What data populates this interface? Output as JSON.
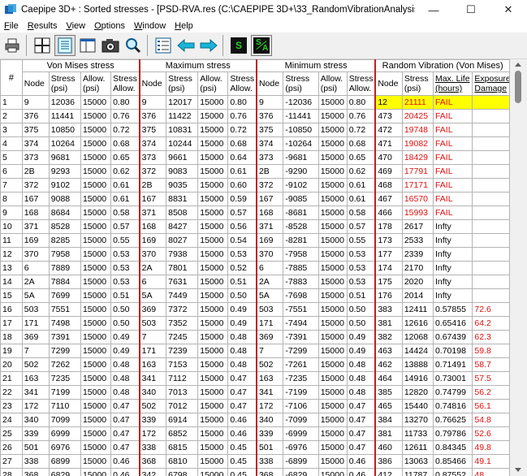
{
  "window": {
    "title": "Caepipe 3D+ : Sorted stresses -  [PSD-RVA.res (C:\\CAEPIPE 3D+\\33_RandomVibrationAnalysis)]",
    "minimize_glyph": "—",
    "maximize_glyph": "☐",
    "close_glyph": "✕"
  },
  "menu": [
    {
      "key": "F",
      "rest": "ile"
    },
    {
      "key": "R",
      "rest": "esults"
    },
    {
      "key": "V",
      "rest": "iew"
    },
    {
      "key": "O",
      "rest": "ptions"
    },
    {
      "key": "W",
      "rest": "indow"
    },
    {
      "key": "H",
      "rest": "elp"
    }
  ],
  "toolbar": {
    "icons": [
      "print-icon",
      "grid-icon",
      "sorted-stresses-icon",
      "window-icon",
      "camera-icon",
      "zoom-icon",
      "list-icon",
      "arrow-left-icon",
      "arrow-right-icon",
      "s-icon",
      "sa-icon"
    ],
    "s_label": "S",
    "sa_label_s": "S",
    "sa_label_a": "A"
  },
  "colors": {
    "accent_red": "#e01010",
    "highlight": "#ffff00",
    "separator": "#c02020",
    "toolbar_green": "#0a8a0a",
    "arrow_cyan": "#19b5d8"
  },
  "grid": {
    "hash_label": "#",
    "groups": {
      "von_mises": "Von Mises stress",
      "maximum": "Maximum stress",
      "minimum": "Minimum stress",
      "random": "Random Vibration (Von Mises)"
    },
    "col_headers": {
      "node": "Node",
      "stress_1": "Stress",
      "stress_2": "(psi)",
      "allow_1": "Allow.",
      "allow_2": "(psi)",
      "sallow_1": "Stress",
      "sallow_2": "Allow.",
      "life_1": "Max. Life",
      "life_2": "(hours)",
      "exposure_1": "Exposure",
      "exposure_2": "Damage"
    },
    "rows": [
      {
        "n": "1",
        "vn": "9",
        "vs": "12036",
        "va": "15000",
        "vr": "0.80",
        "xn": "9",
        "xs": "12017",
        "xa": "15000",
        "xr": "0.80",
        "mn": "9",
        "ms": "-12036",
        "ma": "15000",
        "mr": "0.80",
        "rn": "12",
        "rs": "21111",
        "rl": "FAIL",
        "rd": ""
      },
      {
        "n": "2",
        "vn": "376",
        "vs": "11441",
        "va": "15000",
        "vr": "0.76",
        "xn": "376",
        "xs": "11422",
        "xa": "15000",
        "xr": "0.76",
        "mn": "376",
        "ms": "-11441",
        "ma": "15000",
        "mr": "0.76",
        "rn": "473",
        "rs": "20425",
        "rl": "FAIL",
        "rd": ""
      },
      {
        "n": "3",
        "vn": "375",
        "vs": "10850",
        "va": "15000",
        "vr": "0.72",
        "xn": "375",
        "xs": "10831",
        "xa": "15000",
        "xr": "0.72",
        "mn": "375",
        "ms": "-10850",
        "ma": "15000",
        "mr": "0.72",
        "rn": "472",
        "rs": "19748",
        "rl": "FAIL",
        "rd": ""
      },
      {
        "n": "4",
        "vn": "374",
        "vs": "10264",
        "va": "15000",
        "vr": "0.68",
        "xn": "374",
        "xs": "10244",
        "xa": "15000",
        "xr": "0.68",
        "mn": "374",
        "ms": "-10264",
        "ma": "15000",
        "mr": "0.68",
        "rn": "471",
        "rs": "19082",
        "rl": "FAIL",
        "rd": ""
      },
      {
        "n": "5",
        "vn": "373",
        "vs": "9681",
        "va": "15000",
        "vr": "0.65",
        "xn": "373",
        "xs": "9661",
        "xa": "15000",
        "xr": "0.64",
        "mn": "373",
        "ms": "-9681",
        "ma": "15000",
        "mr": "0.65",
        "rn": "470",
        "rs": "18429",
        "rl": "FAIL",
        "rd": ""
      },
      {
        "n": "6",
        "vn": "2B",
        "vs": "9293",
        "va": "15000",
        "vr": "0.62",
        "xn": "372",
        "xs": "9083",
        "xa": "15000",
        "xr": "0.61",
        "mn": "2B",
        "ms": "-9290",
        "ma": "15000",
        "mr": "0.62",
        "rn": "469",
        "rs": "17791",
        "rl": "FAIL",
        "rd": ""
      },
      {
        "n": "7",
        "vn": "372",
        "vs": "9102",
        "va": "15000",
        "vr": "0.61",
        "xn": "2B",
        "xs": "9035",
        "xa": "15000",
        "xr": "0.60",
        "mn": "372",
        "ms": "-9102",
        "ma": "15000",
        "mr": "0.61",
        "rn": "468",
        "rs": "17171",
        "rl": "FAIL",
        "rd": ""
      },
      {
        "n": "8",
        "vn": "167",
        "vs": "9088",
        "va": "15000",
        "vr": "0.61",
        "xn": "167",
        "xs": "8831",
        "xa": "15000",
        "xr": "0.59",
        "mn": "167",
        "ms": "-9085",
        "ma": "15000",
        "mr": "0.61",
        "rn": "467",
        "rs": "16570",
        "rl": "FAIL",
        "rd": ""
      },
      {
        "n": "9",
        "vn": "168",
        "vs": "8684",
        "va": "15000",
        "vr": "0.58",
        "xn": "371",
        "xs": "8508",
        "xa": "15000",
        "xr": "0.57",
        "mn": "168",
        "ms": "-8681",
        "ma": "15000",
        "mr": "0.58",
        "rn": "466",
        "rs": "15993",
        "rl": "FAIL",
        "rd": ""
      },
      {
        "n": "10",
        "vn": "371",
        "vs": "8528",
        "va": "15000",
        "vr": "0.57",
        "xn": "168",
        "xs": "8427",
        "xa": "15000",
        "xr": "0.56",
        "mn": "371",
        "ms": "-8528",
        "ma": "15000",
        "mr": "0.57",
        "rn": "178",
        "rs": "2617",
        "rl": "Infty",
        "rd": ""
      },
      {
        "n": "11",
        "vn": "169",
        "vs": "8285",
        "va": "15000",
        "vr": "0.55",
        "xn": "169",
        "xs": "8027",
        "xa": "15000",
        "xr": "0.54",
        "mn": "169",
        "ms": "-8281",
        "ma": "15000",
        "mr": "0.55",
        "rn": "173",
        "rs": "2533",
        "rl": "Infty",
        "rd": ""
      },
      {
        "n": "12",
        "vn": "370",
        "vs": "7958",
        "va": "15000",
        "vr": "0.53",
        "xn": "370",
        "xs": "7938",
        "xa": "15000",
        "xr": "0.53",
        "mn": "370",
        "ms": "-7958",
        "ma": "15000",
        "mr": "0.53",
        "rn": "177",
        "rs": "2339",
        "rl": "Infty",
        "rd": ""
      },
      {
        "n": "13",
        "vn": "6",
        "vs": "7889",
        "va": "15000",
        "vr": "0.53",
        "xn": "2A",
        "xs": "7801",
        "xa": "15000",
        "xr": "0.52",
        "mn": "6",
        "ms": "-7885",
        "ma": "15000",
        "mr": "0.53",
        "rn": "174",
        "rs": "2170",
        "rl": "Infty",
        "rd": ""
      },
      {
        "n": "14",
        "vn": "2A",
        "vs": "7884",
        "va": "15000",
        "vr": "0.53",
        "xn": "6",
        "xs": "7631",
        "xa": "15000",
        "xr": "0.51",
        "mn": "2A",
        "ms": "-7883",
        "ma": "15000",
        "mr": "0.53",
        "rn": "175",
        "rs": "2020",
        "rl": "Infty",
        "rd": ""
      },
      {
        "n": "15",
        "vn": "5A",
        "vs": "7699",
        "va": "15000",
        "vr": "0.51",
        "xn": "5A",
        "xs": "7449",
        "xa": "15000",
        "xr": "0.50",
        "mn": "5A",
        "ms": "-7698",
        "ma": "15000",
        "mr": "0.51",
        "rn": "176",
        "rs": "2014",
        "rl": "Infty",
        "rd": ""
      },
      {
        "n": "16",
        "vn": "503",
        "vs": "7551",
        "va": "15000",
        "vr": "0.50",
        "xn": "369",
        "xs": "7372",
        "xa": "15000",
        "xr": "0.49",
        "mn": "503",
        "ms": "-7551",
        "ma": "15000",
        "mr": "0.50",
        "rn": "383",
        "rs": "12411",
        "rl": "0.57855",
        "rd": "72.6"
      },
      {
        "n": "17",
        "vn": "171",
        "vs": "7498",
        "va": "15000",
        "vr": "0.50",
        "xn": "503",
        "xs": "7352",
        "xa": "15000",
        "xr": "0.49",
        "mn": "171",
        "ms": "-7494",
        "ma": "15000",
        "mr": "0.50",
        "rn": "381",
        "rs": "12616",
        "rl": "0.65416",
        "rd": "64.2"
      },
      {
        "n": "18",
        "vn": "369",
        "vs": "7391",
        "va": "15000",
        "vr": "0.49",
        "xn": "7",
        "xs": "7245",
        "xa": "15000",
        "xr": "0.48",
        "mn": "369",
        "ms": "-7391",
        "ma": "15000",
        "mr": "0.49",
        "rn": "382",
        "rs": "12068",
        "rl": "0.67439",
        "rd": "62.3"
      },
      {
        "n": "19",
        "vn": "7",
        "vs": "7299",
        "va": "15000",
        "vr": "0.49",
        "xn": "171",
        "xs": "7239",
        "xa": "15000",
        "xr": "0.48",
        "mn": "7",
        "ms": "-7299",
        "ma": "15000",
        "mr": "0.49",
        "rn": "463",
        "rs": "14424",
        "rl": "0.70198",
        "rd": "59.8"
      },
      {
        "n": "20",
        "vn": "502",
        "vs": "7262",
        "va": "15000",
        "vr": "0.48",
        "xn": "163",
        "xs": "7153",
        "xa": "15000",
        "xr": "0.48",
        "mn": "502",
        "ms": "-7261",
        "ma": "15000",
        "mr": "0.48",
        "rn": "462",
        "rs": "13888",
        "rl": "0.71491",
        "rd": "58.7"
      },
      {
        "n": "21",
        "vn": "163",
        "vs": "7235",
        "va": "15000",
        "vr": "0.48",
        "xn": "341",
        "xs": "7112",
        "xa": "15000",
        "xr": "0.47",
        "mn": "163",
        "ms": "-7235",
        "ma": "15000",
        "mr": "0.48",
        "rn": "464",
        "rs": "14916",
        "rl": "0.73001",
        "rd": "57.5"
      },
      {
        "n": "22",
        "vn": "341",
        "vs": "7199",
        "va": "15000",
        "vr": "0.48",
        "xn": "340",
        "xs": "7013",
        "xa": "15000",
        "xr": "0.47",
        "mn": "341",
        "ms": "-7199",
        "ma": "15000",
        "mr": "0.48",
        "rn": "385",
        "rs": "12820",
        "rl": "0.74799",
        "rd": "56.2"
      },
      {
        "n": "23",
        "vn": "172",
        "vs": "7110",
        "va": "15000",
        "vr": "0.47",
        "xn": "502",
        "xs": "7012",
        "xa": "15000",
        "xr": "0.47",
        "mn": "172",
        "ms": "-7106",
        "ma": "15000",
        "mr": "0.47",
        "rn": "465",
        "rs": "15440",
        "rl": "0.74816",
        "rd": "56.1"
      },
      {
        "n": "24",
        "vn": "340",
        "vs": "7099",
        "va": "15000",
        "vr": "0.47",
        "xn": "339",
        "xs": "6914",
        "xa": "15000",
        "xr": "0.46",
        "mn": "340",
        "ms": "-7099",
        "ma": "15000",
        "mr": "0.47",
        "rn": "384",
        "rs": "13270",
        "rl": "0.76625",
        "rd": "54.8"
      },
      {
        "n": "25",
        "vn": "339",
        "vs": "6999",
        "va": "15000",
        "vr": "0.47",
        "xn": "172",
        "xs": "6852",
        "xa": "15000",
        "xr": "0.46",
        "mn": "339",
        "ms": "-6999",
        "ma": "15000",
        "mr": "0.47",
        "rn": "381",
        "rs": "11733",
        "rl": "0.79786",
        "rd": "52.6"
      },
      {
        "n": "26",
        "vn": "501",
        "vs": "6976",
        "va": "15000",
        "vr": "0.47",
        "xn": "338",
        "xs": "6815",
        "xa": "15000",
        "xr": "0.45",
        "mn": "501",
        "ms": "-6976",
        "ma": "15000",
        "mr": "0.47",
        "rn": "460",
        "rs": "12611",
        "rl": "0.84345",
        "rd": "49.8"
      },
      {
        "n": "27",
        "vn": "338",
        "vs": "6899",
        "va": "15000",
        "vr": "0.46",
        "xn": "368",
        "xs": "6810",
        "xa": "15000",
        "xr": "0.45",
        "mn": "338",
        "ms": "-6899",
        "ma": "15000",
        "mr": "0.46",
        "rn": "386",
        "rs": "13063",
        "rl": "0.85466",
        "rd": "49.1"
      },
      {
        "n": "28",
        "vn": "368",
        "vs": "6829",
        "va": "15000",
        "vr": "0.46",
        "xn": "342",
        "xs": "6798",
        "xa": "15000",
        "xr": "0.45",
        "mn": "368",
        "ms": "-6829",
        "ma": "15000",
        "mr": "0.46",
        "rn": "412",
        "rs": "11787",
        "rl": "0.87552",
        "rd": "48"
      }
    ]
  }
}
